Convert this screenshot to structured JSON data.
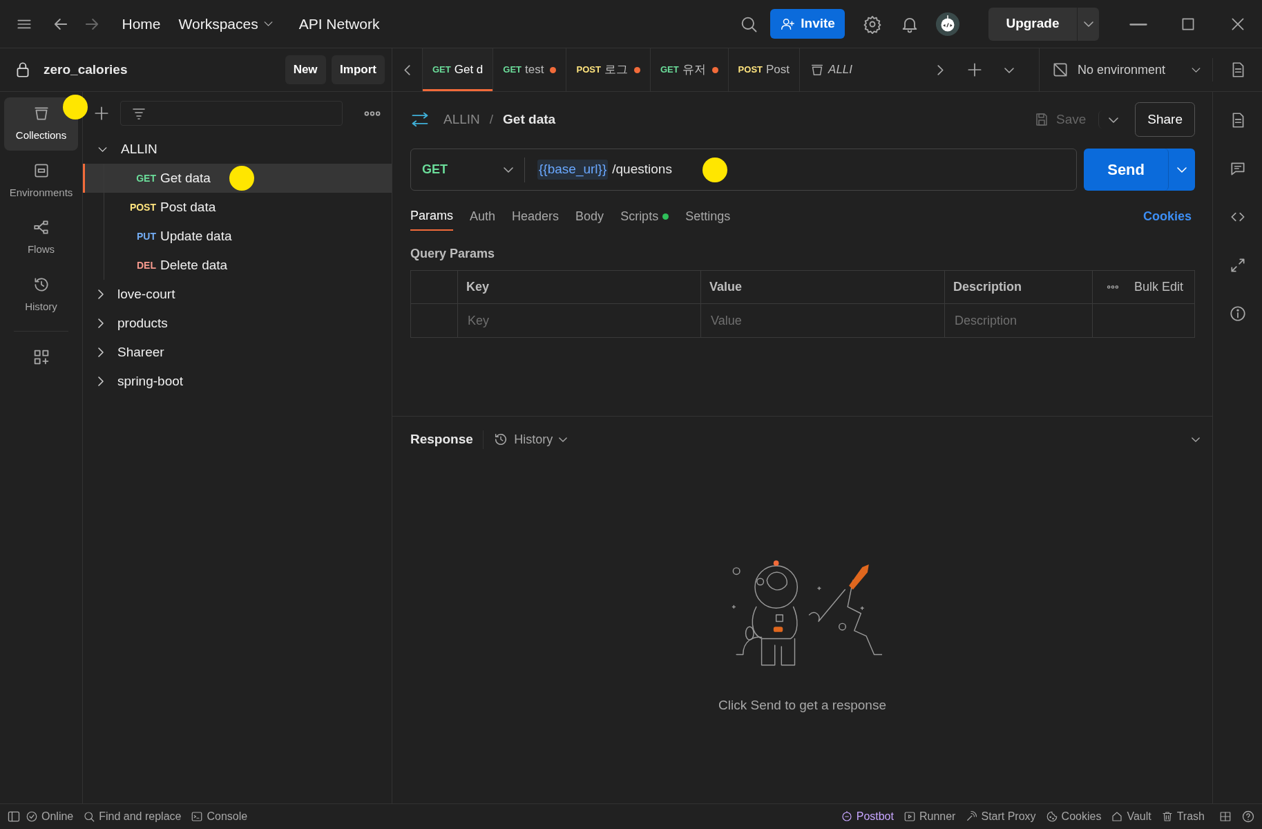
{
  "topbar": {
    "nav": [
      {
        "label": "Home",
        "dropdown": false
      },
      {
        "label": "Workspaces",
        "dropdown": true
      },
      {
        "label": "API Network",
        "dropdown": false
      }
    ],
    "invite": "Invite",
    "upgrade": "Upgrade"
  },
  "workspace": {
    "name": "zero_calories",
    "buttons": [
      "New",
      "Import"
    ]
  },
  "open_tabs": [
    {
      "kind": "request",
      "method": "GET",
      "label": "Get d",
      "selected": true,
      "unsaved": false
    },
    {
      "kind": "request",
      "method": "GET",
      "label": "test",
      "selected": false,
      "unsaved": true
    },
    {
      "kind": "request",
      "method": "POST",
      "label": "로그",
      "selected": false,
      "unsaved": true
    },
    {
      "kind": "request",
      "method": "GET",
      "label": "유저",
      "selected": false,
      "unsaved": true
    },
    {
      "kind": "request",
      "method": "POST",
      "label": "Post",
      "selected": false,
      "unsaved": false
    },
    {
      "kind": "collection",
      "label": "ALLI",
      "selected": false,
      "unsaved": false
    }
  ],
  "environment": "No environment",
  "rail": [
    {
      "label": "Collections",
      "selected": true,
      "marked": true
    },
    {
      "label": "Environments",
      "selected": false,
      "marked": false
    },
    {
      "label": "Flows",
      "selected": false,
      "marked": false
    },
    {
      "label": "History",
      "selected": false,
      "marked": false
    }
  ],
  "tree": [
    {
      "label": "ALLIN",
      "expanded": true,
      "children": [
        {
          "method": "GET",
          "label": "Get data",
          "selected": true,
          "marked": true
        },
        {
          "method": "POST",
          "label": "Post data",
          "selected": false,
          "marked": false
        },
        {
          "method": "PUT",
          "label": "Update data",
          "selected": false,
          "marked": false
        },
        {
          "method": "DEL",
          "label": "Delete data",
          "selected": false,
          "marked": false
        }
      ]
    },
    {
      "label": "love-court",
      "expanded": false
    },
    {
      "label": "products",
      "expanded": false
    },
    {
      "label": "Shareer",
      "expanded": false
    },
    {
      "label": "spring-boot",
      "expanded": false
    }
  ],
  "request": {
    "breadcrumb": [
      "ALLIN",
      "Get data"
    ],
    "breadcrumb_separator": "/",
    "save": "Save",
    "share": "Share",
    "method": "GET",
    "url_variable": "{{base_url}}",
    "url_path": "/questions",
    "url_marked": true,
    "send": "Send"
  },
  "option_tabs": [
    {
      "label": "Params",
      "selected": true,
      "indicator": false
    },
    {
      "label": "Auth",
      "selected": false,
      "indicator": false
    },
    {
      "label": "Headers",
      "selected": false,
      "indicator": false
    },
    {
      "label": "Body",
      "selected": false,
      "indicator": false
    },
    {
      "label": "Scripts",
      "selected": false,
      "indicator": true
    },
    {
      "label": "Settings",
      "selected": false,
      "indicator": false
    }
  ],
  "cookies_link": "Cookies",
  "query_params": {
    "title": "Query Params",
    "columns": [
      "Key",
      "Value",
      "Description"
    ],
    "bulk_edit": "Bulk Edit",
    "placeholders": [
      "Key",
      "Value",
      "Description"
    ]
  },
  "response": {
    "title": "Response",
    "history": "History",
    "empty_message": "Click Send to get a response"
  },
  "status_bar": {
    "left": [
      {
        "label": "Online",
        "accent": false
      },
      {
        "label": "Find and replace",
        "accent": false
      },
      {
        "label": "Console",
        "accent": false
      }
    ],
    "right": [
      {
        "label": "Postbot",
        "accent": true
      },
      {
        "label": "Runner",
        "accent": false
      },
      {
        "label": "Start Proxy",
        "accent": false
      },
      {
        "label": "Cookies",
        "accent": false
      },
      {
        "label": "Vault",
        "accent": false
      },
      {
        "label": "Trash",
        "accent": false
      }
    ]
  }
}
